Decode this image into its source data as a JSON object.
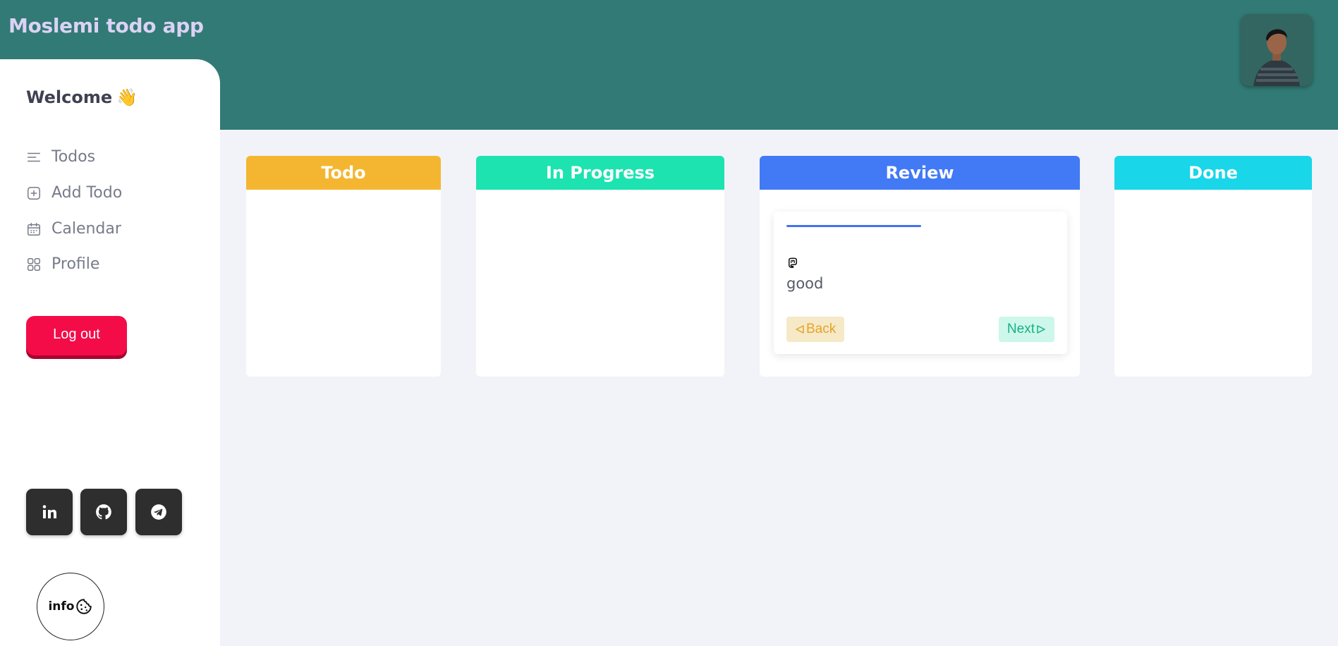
{
  "app": {
    "title": "Moslemi todo app"
  },
  "sidebar": {
    "welcome": "Welcome",
    "welcome_emoji": "👋",
    "items": [
      {
        "label": "Todos",
        "icon": "list-icon"
      },
      {
        "label": "Add Todo",
        "icon": "add-square-icon"
      },
      {
        "label": "Calendar",
        "icon": "calendar-icon"
      },
      {
        "label": "Profile",
        "icon": "grid-icon"
      }
    ],
    "logout_label": "Log out",
    "socials": [
      {
        "icon": "linkedin-icon"
      },
      {
        "icon": "github-icon"
      },
      {
        "icon": "telegram-icon"
      }
    ],
    "info_label": "info",
    "info_icon": "cookie-icon"
  },
  "board": {
    "columns": [
      {
        "title": "Todo",
        "color": "#f4b631"
      },
      {
        "title": "In Progress",
        "color": "#1de3b1"
      },
      {
        "title": "Review",
        "color": "#4279f5"
      },
      {
        "title": "Done",
        "color": "#19d6e8"
      }
    ],
    "review_card": {
      "accent": "#4274ee",
      "text": "good",
      "back_label": "Back",
      "next_label": "Next"
    }
  },
  "colors": {
    "header": "#327a75",
    "title": "#dcd2f5",
    "logout": "#f40c49",
    "background": "#f2f3f8"
  }
}
